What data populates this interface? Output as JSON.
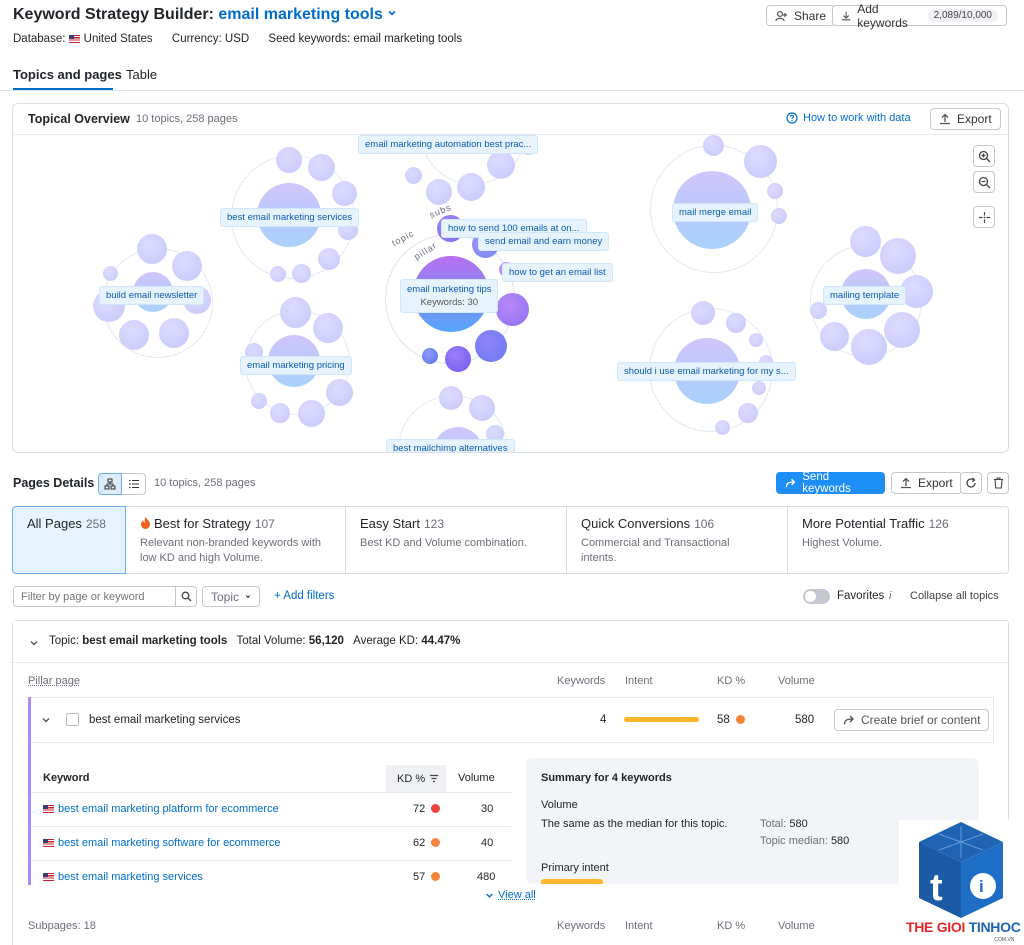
{
  "header": {
    "title_prefix": "Keyword Strategy Builder:",
    "title_project": "email marketing tools",
    "database_label": "Database:",
    "database_value": "United States",
    "currency": "Currency: USD",
    "seed": "Seed keywords: email marketing tools",
    "share_label": "Share",
    "add_keywords_label": "Add keywords",
    "add_keywords_count": "2,089/10,000"
  },
  "tabs": {
    "topics_pages": "Topics and pages",
    "table": "Table"
  },
  "overview": {
    "title": "Topical Overview",
    "meta": "10 topics, 258 pages",
    "how_to": "How to work with data",
    "export": "Export",
    "ring_words": {
      "topic": "topic",
      "pillar": "pillar",
      "subs": "subs"
    },
    "labels": {
      "automation": "email marketing automation best prac...",
      "services": "best email marketing services",
      "newsletter": "build email newsletter",
      "pricing": "email marketing pricing",
      "mailchimp": "best mailchimp alternatives",
      "send100": "how to send 100 emails at on...",
      "earn": "send email and earn money",
      "list": "how to get an email list",
      "tips": "email marketing tips",
      "tips_kw": "Keywords: 30",
      "merge": "mail merge email",
      "template": "mailing template",
      "shouldi": "should i use email marketing for my s..."
    }
  },
  "pages_details": {
    "title": "Pages Details",
    "meta": "10 topics, 258 pages",
    "send_keywords": "Send keywords",
    "export": "Export"
  },
  "strategy_tabs": [
    {
      "title": "All Pages",
      "count": "258",
      "desc": ""
    },
    {
      "title": "Best for Strategy",
      "count": "107",
      "desc": "Relevant non-branded keywords with low KD and high Volume."
    },
    {
      "title": "Easy Start",
      "count": "123",
      "desc": "Best KD and Volume combination."
    },
    {
      "title": "Quick Conversions",
      "count": "106",
      "desc": "Commercial and Transactional intents."
    },
    {
      "title": "More Potential Traffic",
      "count": "126",
      "desc": "Highest Volume."
    }
  ],
  "filters": {
    "search_placeholder": "Filter by page or keyword",
    "topic": "Topic",
    "add_filters": "+ Add filters",
    "favorites": "Favorites",
    "info": "i",
    "collapse": "Collapse all topics"
  },
  "topic_group": {
    "label": "Topic:",
    "name": "best email marketing tools",
    "total_volume_label": "Total Volume:",
    "total_volume": "56,120",
    "avg_kd_label": "Average KD:",
    "avg_kd": "44.47%"
  },
  "pillar_header": {
    "pillar_page": "Pillar page",
    "keywords": "Keywords",
    "intent": "Intent",
    "kd": "KD %",
    "volume": "Volume"
  },
  "pillar_row": {
    "name": "best email marketing services",
    "keywords": "4",
    "kd": "58",
    "volume": "580",
    "create_brief": "Create brief or content"
  },
  "kw_table": {
    "col_keyword": "Keyword",
    "col_kd": "KD %",
    "col_volume": "Volume",
    "rows": [
      {
        "keyword": "best email marketing platform for ecommerce",
        "kd": "72",
        "volume": "30",
        "color": "#f2433b"
      },
      {
        "keyword": "best email marketing software for ecommerce",
        "kd": "62",
        "volume": "40",
        "color": "#f5843d"
      },
      {
        "keyword": "best email marketing services",
        "kd": "57",
        "volume": "480",
        "color": "#f5843d"
      }
    ],
    "view_all": "View all"
  },
  "summary": {
    "title": "Summary for 4 keywords",
    "volume_title": "Volume",
    "volume_desc": "The same as the median for this topic.",
    "total_label": "Total:",
    "total_value": "580",
    "median_label": "Topic median:",
    "median_value": "580",
    "intent_title": "Primary intent"
  },
  "subpages_header": {
    "subpages": "Subpages: 18",
    "keywords": "Keywords",
    "intent": "Intent",
    "kd": "KD %",
    "volume": "Volume"
  },
  "watermark": {
    "brand_a": "THE GIOI ",
    "brand_b": "TINHOC",
    "domain": ".COM.VN"
  },
  "colors": {
    "accent_blue": "#006dca",
    "primary_button": "#1e8ef7",
    "intent_bar": "#fcb62b",
    "kd_orange": "#f5843d",
    "kd_red": "#f2433b"
  }
}
